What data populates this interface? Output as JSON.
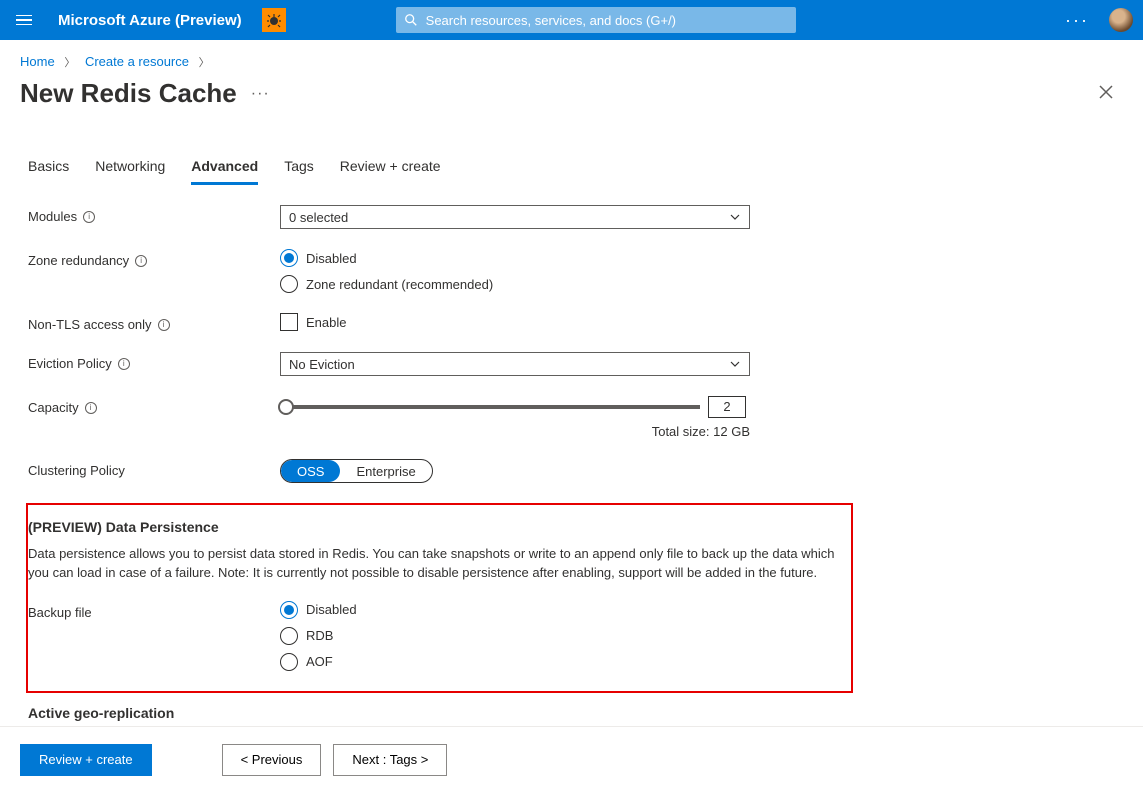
{
  "header": {
    "brand": "Microsoft Azure (Preview)",
    "search_placeholder": "Search resources, services, and docs (G+/)"
  },
  "breadcrumb": {
    "items": [
      "Home",
      "Create a resource"
    ]
  },
  "page": {
    "title": "New Redis Cache"
  },
  "tabs": [
    "Basics",
    "Networking",
    "Advanced",
    "Tags",
    "Review + create"
  ],
  "active_tab": "Advanced",
  "form": {
    "modules_label": "Modules",
    "modules_value": "0 selected",
    "zone_label": "Zone redundancy",
    "zone_options": {
      "disabled": "Disabled",
      "recommended": "Zone redundant (recommended)"
    },
    "nontls_label": "Non-TLS access only",
    "nontls_option": "Enable",
    "eviction_label": "Eviction Policy",
    "eviction_value": "No Eviction",
    "capacity_label": "Capacity",
    "capacity_value": "2",
    "capacity_total": "Total size: 12 GB",
    "clustering_label": "Clustering Policy",
    "clustering_options": {
      "oss": "OSS",
      "enterprise": "Enterprise"
    }
  },
  "persistence": {
    "heading": "(PREVIEW) Data Persistence",
    "description": "Data persistence allows you to persist data stored in Redis. You can take snapshots or write to an append only file to back up the data which you can load in case of a failure. Note: It is currently not possible to disable persistence after enabling, support will be added in the future.",
    "backup_label": "Backup file",
    "options": {
      "disabled": "Disabled",
      "rdb": "RDB",
      "aof": "AOF"
    }
  },
  "geo": {
    "heading": "Active geo-replication"
  },
  "footer": {
    "review": "Review + create",
    "previous": "<  Previous",
    "next": "Next : Tags  >"
  }
}
